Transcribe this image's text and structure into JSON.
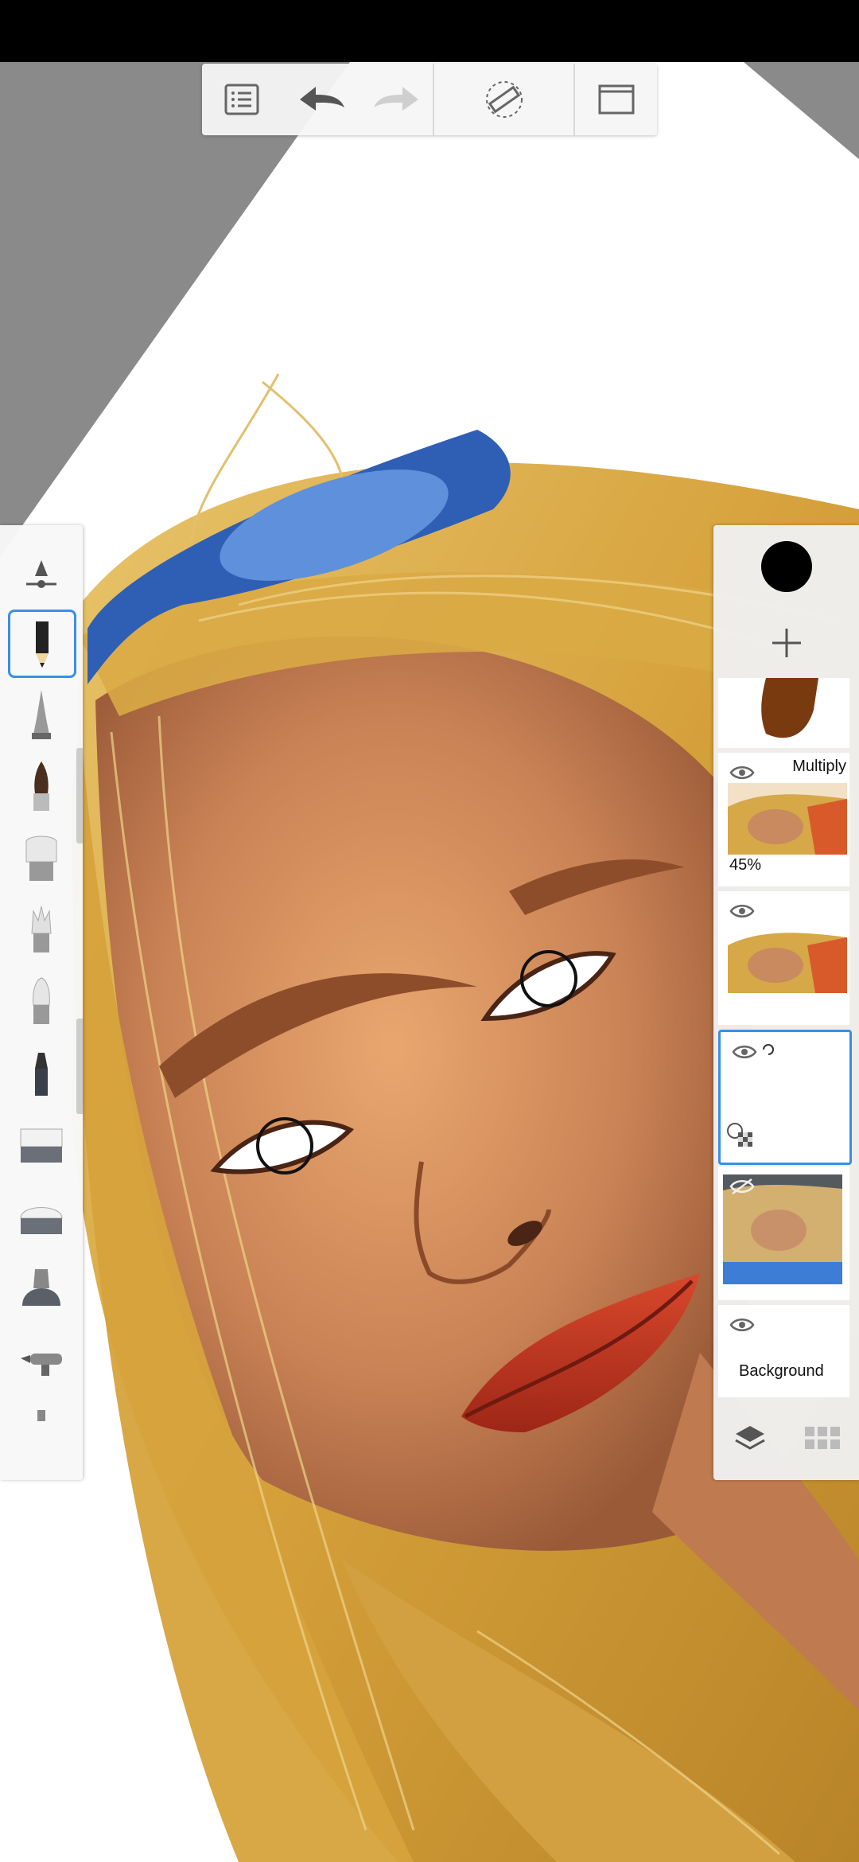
{
  "app": {
    "status_bar": "",
    "toolbar": {
      "items": [
        {
          "name": "list-icon"
        },
        {
          "name": "undo-icon"
        },
        {
          "name": "redo-icon"
        },
        {
          "name": "ruler-icon"
        },
        {
          "name": "fullscreen-icon"
        }
      ]
    },
    "brushes": [
      {
        "name": "brush-properties-icon"
      },
      {
        "name": "pencil-brush-icon",
        "selected": true
      },
      {
        "name": "ballpoint-pen-icon"
      },
      {
        "name": "paintbrush-icon"
      },
      {
        "name": "wide-brush-icon"
      },
      {
        "name": "splatter-brush-icon"
      },
      {
        "name": "soft-brush-icon"
      },
      {
        "name": "marker-icon"
      },
      {
        "name": "hard-eraser-icon"
      },
      {
        "name": "soft-eraser-icon"
      },
      {
        "name": "smudge-icon"
      },
      {
        "name": "airbrush-icon"
      }
    ],
    "layers": {
      "color": "#000000",
      "items": [
        {
          "name": "layer-hair-sketch"
        },
        {
          "name": "layer-multiply",
          "blend_mode": "Multiply",
          "opacity": "45%"
        },
        {
          "name": "layer-portrait"
        },
        {
          "name": "layer-empty-selected",
          "selected": true
        },
        {
          "name": "layer-photo",
          "hidden": true
        },
        {
          "name": "layer-background",
          "label": "Background"
        }
      ]
    },
    "colors": {
      "accent": "#3a8ee6",
      "hair": "#d9a63a",
      "skin": "#c98a5c",
      "lips": "#b7301e",
      "glasses": "#4a7fd0"
    }
  }
}
